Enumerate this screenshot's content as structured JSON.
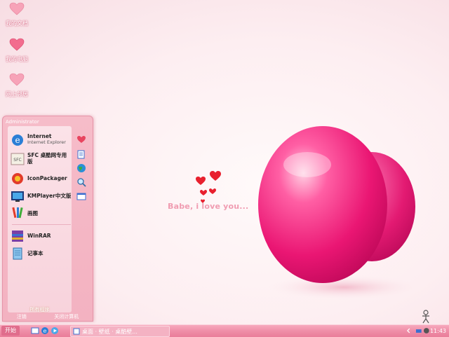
{
  "desktop": {
    "icons": [
      {
        "label": "我的文档",
        "icon": "heart-icon"
      },
      {
        "label": "我的电脑",
        "icon": "heart-icon"
      },
      {
        "label": "网上邻居",
        "icon": "heart-icon"
      }
    ],
    "slogan": "Babe, i love you..."
  },
  "start_menu": {
    "user": "Administrator",
    "items": [
      {
        "label": "Internet",
        "sub": "Internet Explorer",
        "icon": "ie-icon"
      },
      {
        "label": "SFC 桌酷网专用版",
        "sub": "",
        "icon": "sfc-icon"
      },
      {
        "label": "IconPackager",
        "sub": "",
        "icon": "iconpackager-icon"
      },
      {
        "label": "KMPlayer中文版",
        "sub": "",
        "icon": "kmplayer-icon"
      },
      {
        "label": "画图",
        "sub": "",
        "icon": "paint-icon"
      },
      {
        "label": "WinRAR",
        "sub": "",
        "icon": "winrar-icon"
      },
      {
        "label": "记事本",
        "sub": "",
        "icon": "notepad-icon"
      }
    ],
    "all_programs": "所有程序",
    "logoff": "注销",
    "shutdown": "关闭计算机"
  },
  "taskbar": {
    "start_label": "开始",
    "task_label": "桌面 · 壁纸 · 桌酷壁...",
    "clock": "11:43"
  },
  "colors": {
    "heart": "#f0207a",
    "accent": "#ef8ea8"
  }
}
